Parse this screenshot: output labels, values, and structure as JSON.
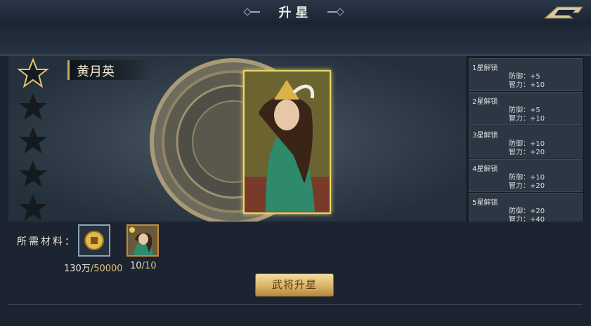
{
  "header": {
    "title": "升星"
  },
  "hero": {
    "name": "黄月英",
    "stars_lit": 1,
    "stars_total": 5
  },
  "unlocks": [
    {
      "title": "1星解锁",
      "stat1": "防御：+5",
      "stat2": "智力：+10"
    },
    {
      "title": "2星解锁",
      "stat1": "防御：+5",
      "stat2": "智力：+10"
    },
    {
      "title": "3星解锁",
      "stat1": "防御：+10",
      "stat2": "智力：+20"
    },
    {
      "title": "4星解锁",
      "stat1": "防御：+10",
      "stat2": "智力：+20"
    },
    {
      "title": "5星解锁",
      "stat1": "防御：+20",
      "stat2": "智力：+40"
    }
  ],
  "materials": {
    "label": "所需材料：",
    "coin": {
      "have": "130万",
      "need": "/50000"
    },
    "hero_shard": {
      "have": "10",
      "need": "/10"
    }
  },
  "actions": {
    "upgrade_label": "武将升星"
  },
  "colors": {
    "gold": "#c9a861",
    "portrait_border": "#e8d86a",
    "button": "#d8b466"
  }
}
